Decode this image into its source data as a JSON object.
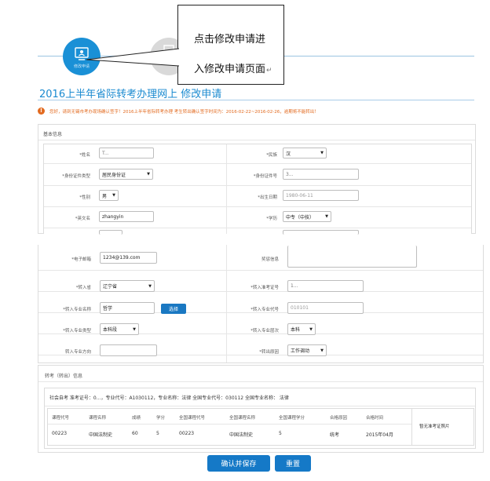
{
  "callout": {
    "line1": "点击修改申请进",
    "line2": "入修改申请页面",
    "return_mark": "↵"
  },
  "steps": [
    {
      "label": "修改申请"
    }
  ],
  "page_title": "2016上半年省际转考办理网上 修改申请",
  "notice": "您好，请到无锡市考办现场确认签字！2016上半年省际转考办理 考生转出确认签字时间为：2016-02-22~2016-02-26，逾期将不能转出！",
  "basic_section": "基本信息",
  "basic": {
    "name_label": "*姓名",
    "name_value": "T...",
    "ethnic_label": "*民族",
    "ethnic_value": "汉",
    "idtype_label": "*身份证件类型",
    "idtype_value": "居民身份证",
    "idno_label": "*身份证件号",
    "idno_value": "3...",
    "gender_label": "*性别",
    "gender_value": "男",
    "birth_label": "*出生日期",
    "birth_value": "1980-06-11",
    "ename_label": "*英文名",
    "ename_value": "zhangyin",
    "edu_label": "*学历",
    "edu_value": "中专（中技）"
  },
  "form2": {
    "email_label": "*电子邮箱",
    "email_value": "1234@139.com",
    "reward_label": "奖惩信息",
    "prov_label": "*转入省",
    "prov_value": "辽宁省",
    "ticket_label": "*转入准考证号",
    "ticket_value": "1...",
    "major_label": "*转入专业名称",
    "major_value": "哲学",
    "choose_btn": "选择",
    "majorcode_label": "*转入专业代号",
    "majorcode_value": "010101",
    "majortype_label": "*转入专业类型",
    "majortype_value": "本科段",
    "level_label": "*转入专业层次",
    "level_value": "本科",
    "direction_label": "转入专业方向",
    "reason_label": "*转出原因",
    "reason_value": "工作调动"
  },
  "transfer_section": "转考（转出）信息",
  "exam_info": "社会自考   准考证号：0...，专业代号：A1030112，专业名称：法律 全国专业代号：030112 全国专业名称：  法律",
  "course_table": {
    "headers": [
      "课程代号",
      "课程名称",
      "成绩",
      "学分",
      "全国课程代号",
      "全国课程名称",
      "全国课程学分",
      "合格原因",
      "合格时间"
    ],
    "rows": [
      [
        "00223",
        "中国法制史",
        "60",
        "5",
        "00223",
        "中国法制史",
        "5",
        "统考",
        "2015年04月"
      ]
    ],
    "photo_note": "暂无准考证照片"
  },
  "buttons": {
    "save": "确认并保存",
    "reset": "重置"
  },
  "colors": {
    "primary": "#1a8ad0",
    "warning": "#e26a1f"
  }
}
